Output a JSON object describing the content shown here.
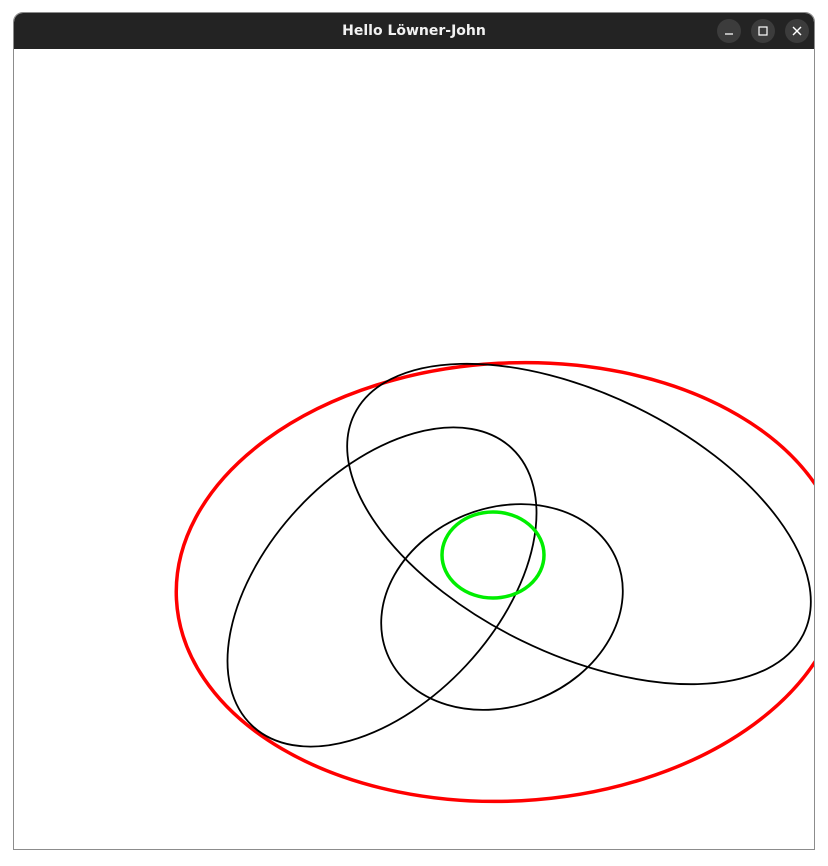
{
  "window": {
    "title": "Hello Löwner-John",
    "titlebar_color": "#232323",
    "buttons": [
      {
        "name": "minimize",
        "icon": "minimize-icon"
      },
      {
        "name": "maximize",
        "icon": "maximize-icon"
      },
      {
        "name": "close",
        "icon": "close-icon"
      }
    ]
  },
  "canvas": {
    "background": "#ffffff",
    "input_ellipses": {
      "color": "#000000",
      "count": 3
    },
    "outer_ellipse": {
      "color": "#ff0000",
      "role": "enclosing ellipse"
    },
    "inner_ellipse": {
      "color": "#00ff00",
      "role": "inscribed ellipse"
    }
  }
}
